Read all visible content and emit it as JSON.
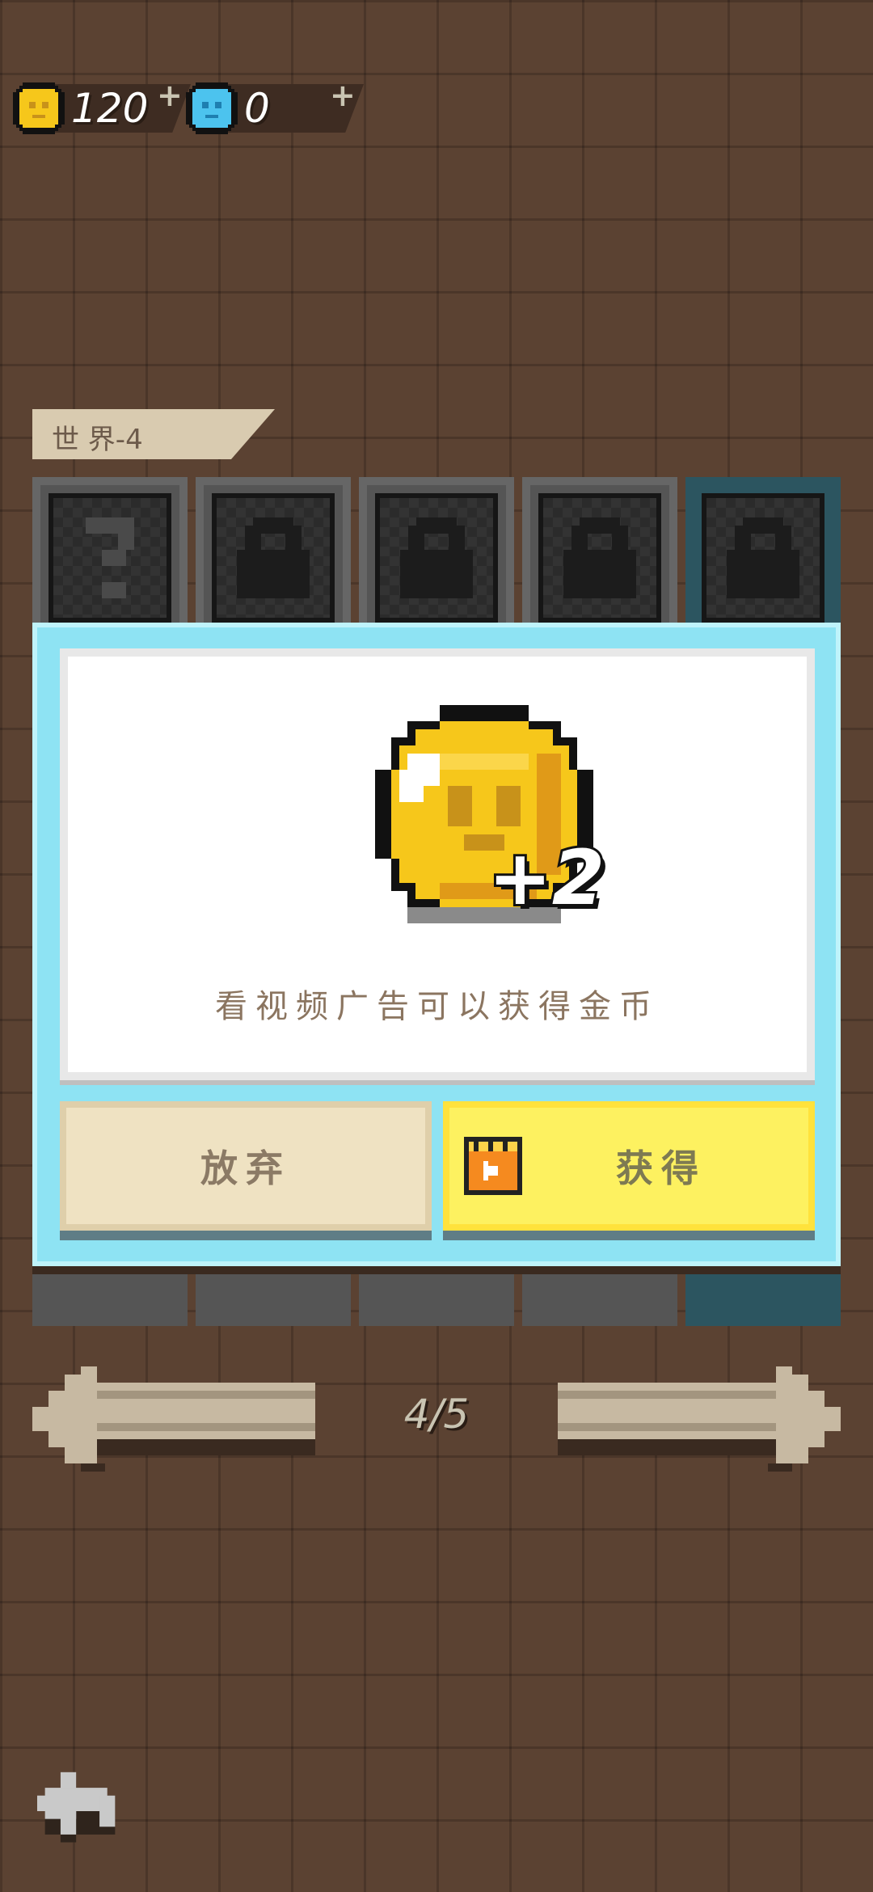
{
  "currency": {
    "coins": {
      "value": "120",
      "icon": "gold-coin-icon"
    },
    "gems": {
      "value": "0",
      "icon": "blue-gem-icon"
    },
    "add_symbol": "+"
  },
  "world": {
    "label": "世 界-4"
  },
  "slots": [
    {
      "state": "unknown",
      "icon": "question-mark-icon"
    },
    {
      "state": "locked",
      "icon": "lock-icon"
    },
    {
      "state": "locked",
      "icon": "lock-icon"
    },
    {
      "state": "locked",
      "icon": "lock-icon"
    },
    {
      "state": "locked",
      "icon": "lock-icon"
    }
  ],
  "dialog": {
    "reward": "+2",
    "description": "看视频广告可以获得金币",
    "give_up_label": "放弃",
    "get_label": "获得"
  },
  "pager": {
    "text": "4/5"
  },
  "colors": {
    "coin": "#f6c71b",
    "dialog": "#8ee3f3",
    "get_button": "#fdf160",
    "give_button": "#efe2c2"
  }
}
